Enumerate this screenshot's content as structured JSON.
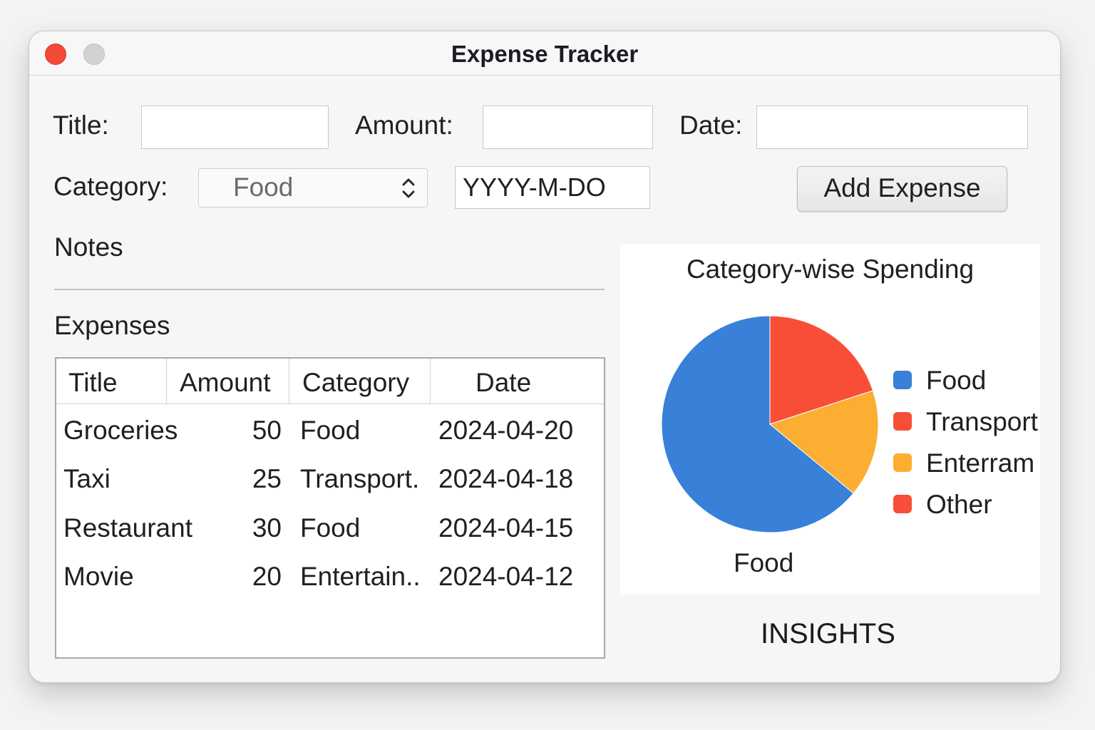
{
  "window": {
    "title": "Expense Tracker"
  },
  "form": {
    "title_label": "Title:",
    "title_value": "",
    "amount_label": "Amount:",
    "amount_value": "",
    "date_label": "Date:",
    "date_value": "",
    "category_label": "Category:",
    "category_selected": "Food",
    "date_format_value": "YYYY-M-DO",
    "add_button_label": "Add Expense"
  },
  "notes": {
    "label": "Notes"
  },
  "expenses": {
    "label": "Expenses",
    "columns": [
      "Title",
      "Amount",
      "Category",
      "Date"
    ],
    "rows": [
      {
        "title": "Groceries",
        "amount": "50",
        "category": "Food",
        "date": "2024-04-20"
      },
      {
        "title": "Taxi",
        "amount": "25",
        "category": "Transport.",
        "date": "2024-04-18"
      },
      {
        "title": "Restaurant",
        "amount": "30",
        "category": "Food",
        "date": "2024-04-15"
      },
      {
        "title": "Movie",
        "amount": "20",
        "category": "Entertain..",
        "date": "2024-04-12"
      }
    ]
  },
  "chart_data": {
    "type": "pie",
    "title": "Category-wise Spending",
    "slices": [
      {
        "label": "Food",
        "value": 64,
        "color": "#3880d8"
      },
      {
        "label": "Transport",
        "value": 20,
        "color": "#f84e37"
      },
      {
        "label": "Enterram",
        "value": 16,
        "color": "#fbae32"
      }
    ],
    "legend": [
      {
        "label": "Food",
        "color": "#3880d8"
      },
      {
        "label": "Transport",
        "color": "#f84e37"
      },
      {
        "label": "Enterram",
        "color": "#fbae32"
      },
      {
        "label": "Other",
        "color": "#f84e37"
      }
    ],
    "slice_caption": "Food",
    "legend_position": "right"
  },
  "insights": {
    "label": "INSIGHTS"
  }
}
